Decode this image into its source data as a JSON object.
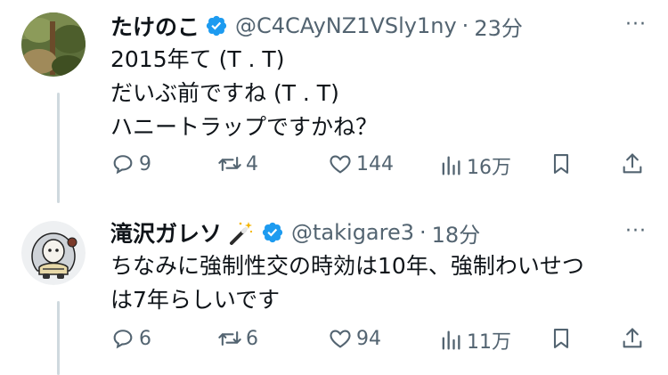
{
  "tweets": [
    {
      "author": "たけのこ",
      "handle": "@C4CAyNZ1VSly1ny",
      "separator": "·",
      "time": "23分",
      "verified": true,
      "lines": [
        "2015年て (T . T)",
        "だいぶ前ですね (T . T)",
        "ハニートラップですかね？"
      ],
      "replies": "9",
      "retweets": "4",
      "likes": "144",
      "views": "16万"
    },
    {
      "author": "滝沢ガレソ",
      "handle": "@takigare3",
      "separator": "·",
      "time": "18分",
      "verified": true,
      "lines": [
        "ちなみに強制性交の時効は10年、強制わいせつ",
        "は7年らしいです"
      ],
      "replies": "6",
      "retweets": "6",
      "likes": "94",
      "views": "11万"
    }
  ],
  "more_label": "···",
  "colors": {
    "verified": "#1d9bf0",
    "muted": "#536471",
    "text": "#0f1419",
    "thread": "#cfd9de"
  }
}
